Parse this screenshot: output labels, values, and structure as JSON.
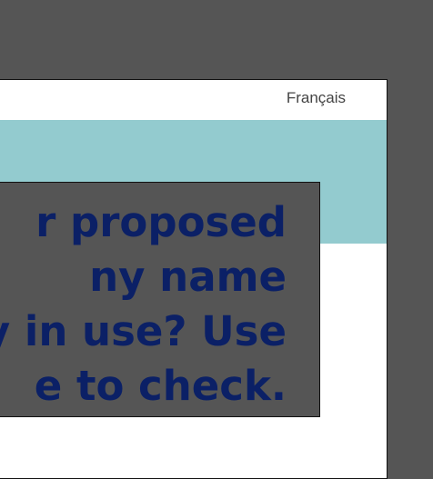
{
  "header": {
    "language_link": "Français"
  },
  "colors": {
    "backdrop": "#555555",
    "banner": "#93cbcf",
    "overlay_text": "#0b2066"
  },
  "overlay": {
    "lines": [
      "r proposed",
      "ny name",
      "y in use? Use",
      "e to check."
    ]
  }
}
